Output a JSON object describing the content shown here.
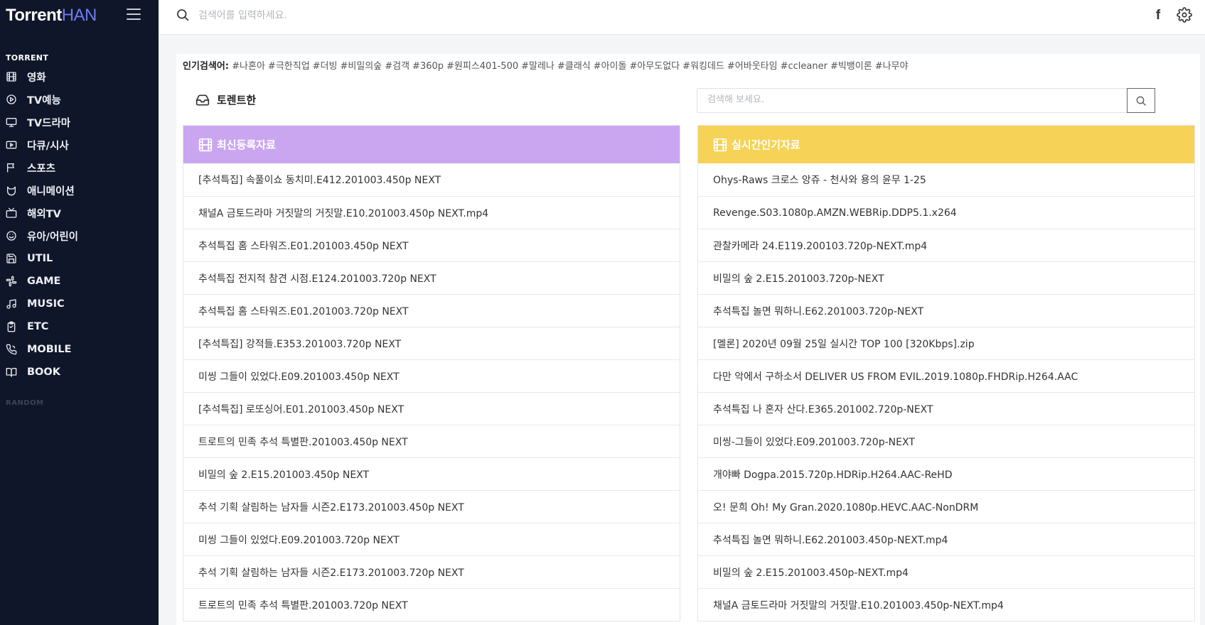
{
  "brand": {
    "part1": "Torrent",
    "part2": "HAN"
  },
  "topbar": {
    "search_placeholder": "검색어를 입력하세요."
  },
  "sidebar": {
    "section": "TORRENT",
    "random": "RANDOM",
    "items": [
      {
        "label": "영화",
        "icon": "film-icon"
      },
      {
        "label": "TV예능",
        "icon": "play-circle-icon"
      },
      {
        "label": "TV드라마",
        "icon": "monitor-icon"
      },
      {
        "label": "다큐/시사",
        "icon": "video-play-icon"
      },
      {
        "label": "스포츠",
        "icon": "flag-icon"
      },
      {
        "label": "애니메이션",
        "icon": "anime-icon"
      },
      {
        "label": "해외TV",
        "icon": "tv-icon"
      },
      {
        "label": "유아/어린이",
        "icon": "smile-icon"
      },
      {
        "label": "UTIL",
        "icon": "save-icon"
      },
      {
        "label": "GAME",
        "icon": "slack-icon"
      },
      {
        "label": "MUSIC",
        "icon": "music-icon"
      },
      {
        "label": "ETC",
        "icon": "clipboard-icon"
      },
      {
        "label": "MOBILE",
        "icon": "phone-icon"
      },
      {
        "label": "BOOK",
        "icon": "book-icon"
      }
    ]
  },
  "popular": {
    "label": "인기검색어:",
    "tags": [
      "#나혼아",
      "#극한직업",
      "#더빙",
      "#비밀의숲",
      "#검객",
      "#360p",
      "#원피스401-500",
      "#말레나",
      "#클래식",
      "#아이돌",
      "#아무도없다",
      "#워킹데드",
      "#어바웃타임",
      "#ccleaner",
      "#빅뱅이론",
      "#나무야"
    ]
  },
  "main": {
    "title": "토렌트한",
    "board_search_placeholder": "검색해 보세요."
  },
  "left_panel": {
    "title": "최신등록자료",
    "color": "#cba6f0",
    "rows": [
      "[추석특집] 속풀이쇼 동치미.E412.201003.450p NEXT",
      "채널A 금토드라마 거짓말의 거짓말.E10.201003.450p NEXT.mp4",
      "추석특집 홈 스타워즈.E01.201003.450p NEXT",
      "추석특집 전지적 참견 시점.E124.201003.720p NEXT",
      "추석특집 홈 스타워즈.E01.201003.720p NEXT",
      "[추석특집] 강적들.E353.201003.720p NEXT",
      "미씽 그들이 있었다.E09.201003.450p NEXT",
      "[추석특집] 로또싱어.E01.201003.450p NEXT",
      "트로트의 민족 추석 특별판.201003.450p NEXT",
      "비밀의 숲 2.E15.201003.450p NEXT",
      "추석 기획 살림하는 남자들 시즌2.E173.201003.450p NEXT",
      "미씽 그들이 있었다.E09.201003.720p NEXT",
      "추석 기획 살림하는 남자들 시즌2.E173.201003.720p NEXT",
      "트로트의 민족 추석 특별판.201003.720p NEXT"
    ]
  },
  "right_panel": {
    "title": "실시간인기자료",
    "color": "#f6d256",
    "rows": [
      "Ohys-Raws 크로스 앙쥬 - 천사와 용의 윤무 1-25",
      "Revenge.S03.1080p.AMZN.WEBRip.DDP5.1.x264",
      "관찰카메라 24.E119.200103.720p-NEXT.mp4",
      "비밀의 숲 2.E15.201003.720p-NEXT",
      "추석특집 놀면 뭐하니.E62.201003.720p-NEXT",
      "[멜론] 2020년 09월 25일 실시간 TOP 100 [320Kbps].zip",
      "다만 악에서 구하소서 DELIVER US FROM EVIL.2019.1080p.FHDRip.H264.AAC",
      "추석특집 나 혼자 산다.E365.201002.720p-NEXT",
      "미씽-그들이 있었다.E09.201003.720p-NEXT",
      "개야빠 Dogpa.2015.720p.HDRip.H264.AAC-ReHD",
      "오! 문희 Oh! My Gran.2020.1080p.HEVC.AAC-NonDRM",
      "추석특집 놀면 뭐하니.E62.201003.450p-NEXT.mp4",
      "비밀의 숲 2.E15.201003.450p-NEXT.mp4",
      "채널A 금토드라마 거짓말의 거짓말.E10.201003.450p-NEXT.mp4"
    ]
  }
}
